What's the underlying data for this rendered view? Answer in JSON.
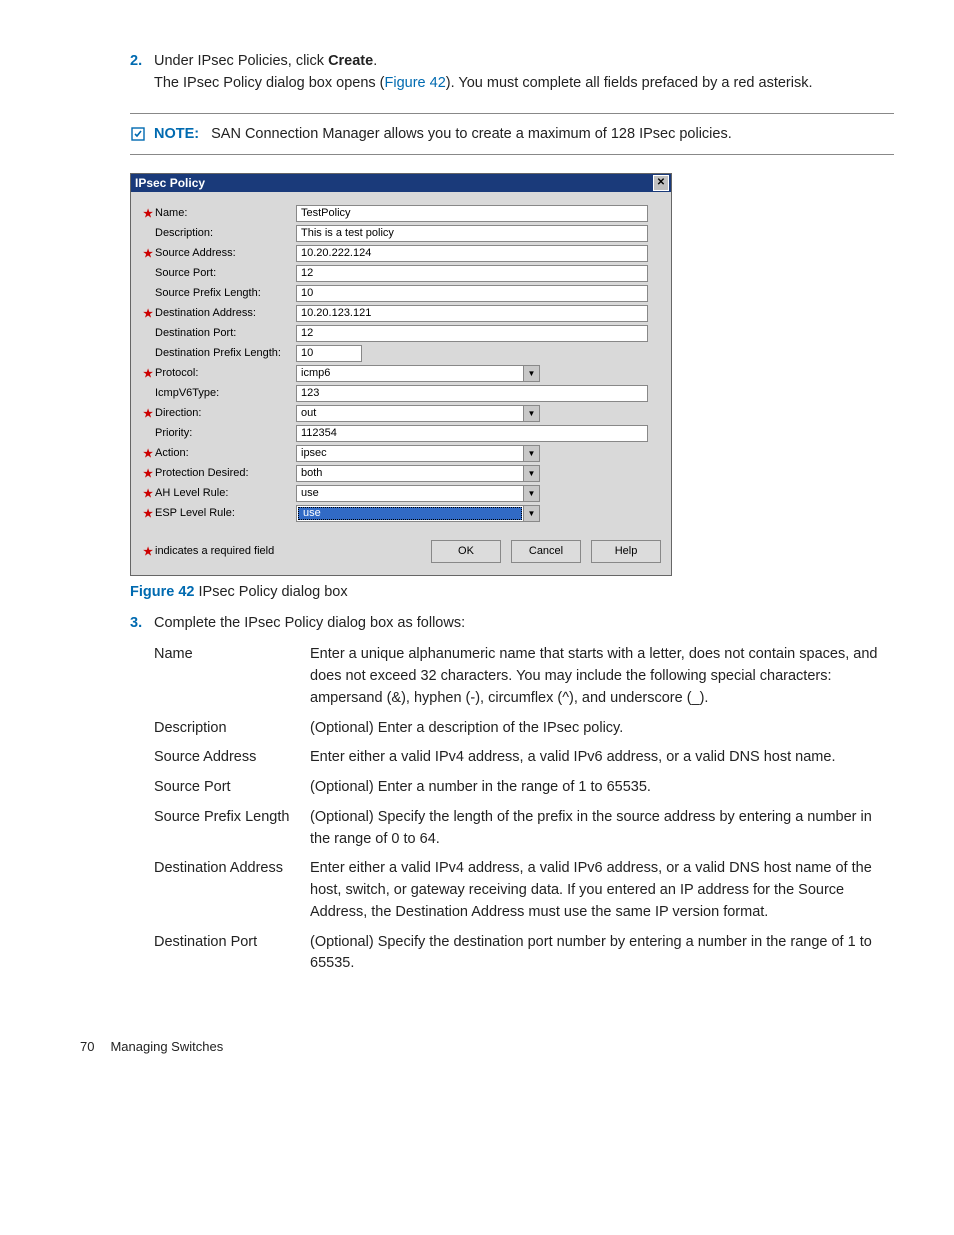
{
  "step2": {
    "num": "2.",
    "line1_a": "Under IPsec Policies, click ",
    "line1_b": "Create",
    "line1_c": ".",
    "line2_a": "The IPsec Policy dialog box opens (",
    "line2_link": "Figure 42",
    "line2_b": "). You must complete all fields prefaced by a red asterisk."
  },
  "note": {
    "label": "NOTE:",
    "text": "SAN Connection Manager allows you to create a maximum of 128 IPsec policies."
  },
  "dialog": {
    "title": "IPsec Policy",
    "fields": {
      "name": {
        "label": "Name:",
        "req": true,
        "value": "TestPolicy"
      },
      "desc": {
        "label": "Description:",
        "req": false,
        "value": "This is a test policy"
      },
      "srcaddr": {
        "label": "Source Address:",
        "req": true,
        "value": "10.20.222.124"
      },
      "srcport": {
        "label": "Source Port:",
        "req": false,
        "value": "12"
      },
      "srcprefix": {
        "label": "Source Prefix Length:",
        "req": false,
        "value": "10"
      },
      "dstaddr": {
        "label": "Destination Address:",
        "req": true,
        "value": "10.20.123.121"
      },
      "dstport": {
        "label": "Destination Port:",
        "req": false,
        "value": "12"
      },
      "dstprefix": {
        "label": "Destination Prefix Length:",
        "req": false,
        "value": "10"
      },
      "protocol": {
        "label": "Protocol:",
        "req": true,
        "value": "icmp6"
      },
      "icmptype": {
        "label": "IcmpV6Type:",
        "req": false,
        "value": "123"
      },
      "direction": {
        "label": "Direction:",
        "req": true,
        "value": "out"
      },
      "priority": {
        "label": "Priority:",
        "req": false,
        "value": "112354"
      },
      "action": {
        "label": "Action:",
        "req": true,
        "value": "ipsec"
      },
      "protdes": {
        "label": "Protection Desired:",
        "req": true,
        "value": "both"
      },
      "ahrule": {
        "label": "AH Level Rule:",
        "req": true,
        "value": "use"
      },
      "esprule": {
        "label": "ESP Level Rule:",
        "req": true,
        "value": "use"
      }
    },
    "required_note": "indicates a required field",
    "buttons": {
      "ok": "OK",
      "cancel": "Cancel",
      "help": "Help"
    }
  },
  "figure": {
    "num": "Figure 42",
    "title": " IPsec Policy dialog box"
  },
  "step3": {
    "num": "3.",
    "text": "Complete the IPsec Policy dialog box as follows:"
  },
  "defs": {
    "name": {
      "term": "Name",
      "desc": "Enter a unique alphanumeric name that starts with a letter, does not contain spaces, and does not exceed 32 characters. You may include the following special characters: ampersand (&), hyphen (-), circumflex (^), and underscore (_)."
    },
    "desc": {
      "term": "Description",
      "desc": "(Optional) Enter a description of the IPsec policy."
    },
    "srcaddr": {
      "term": "Source Address",
      "desc": "Enter either a valid IPv4 address, a valid IPv6 address, or a valid DNS host name."
    },
    "srcport": {
      "term": "Source Port",
      "desc": "(Optional) Enter a number in the range of 1 to 65535."
    },
    "srcprefix": {
      "term": "Source Prefix Length",
      "desc": "(Optional) Specify the length of the prefix in the source address by entering a number in the range of 0 to 64."
    },
    "dstaddr": {
      "term": "Destination Address",
      "desc": "Enter either a valid IPv4 address, a valid IPv6 address, or a valid DNS host name of the host, switch, or gateway receiving data. If you entered an IP address for the Source Address, the Destination Address must use the same IP version format."
    },
    "dstport": {
      "term": "Destination Port",
      "desc": "(Optional) Specify the destination port number by entering a number in the range of 1 to 65535."
    }
  },
  "footer": {
    "pagenum": "70",
    "section": "Managing Switches"
  }
}
